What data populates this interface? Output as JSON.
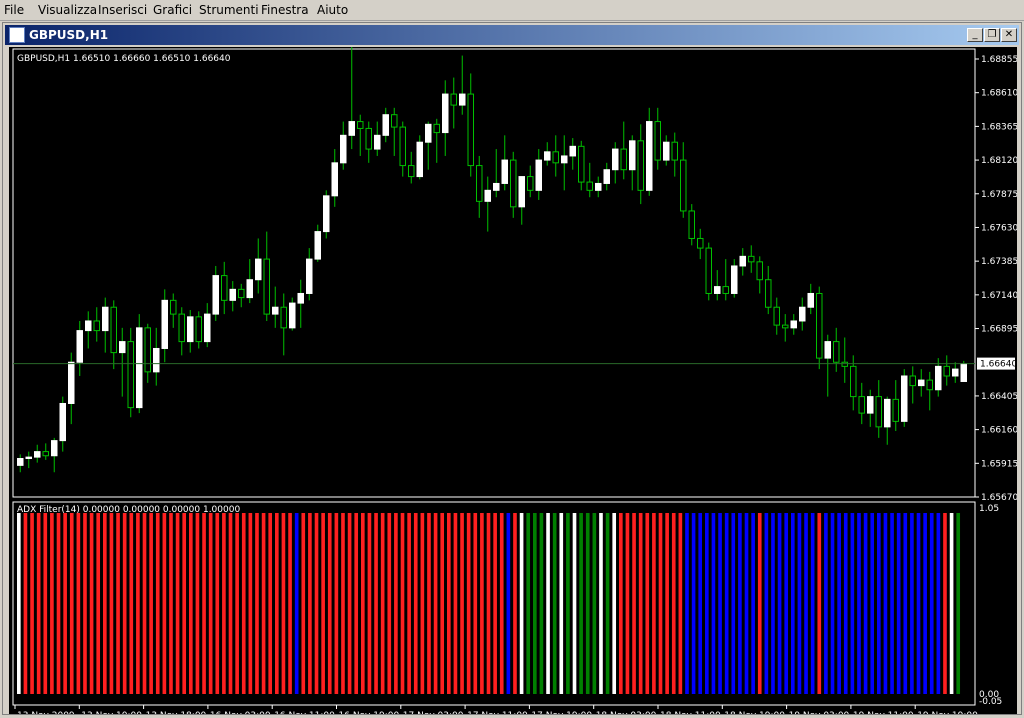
{
  "menu": {
    "items": [
      {
        "label": "File",
        "name": "menu-file"
      },
      {
        "label": "Visualizza",
        "name": "menu-visualizza"
      },
      {
        "label": "Inserisci",
        "name": "menu-inserisci"
      },
      {
        "label": "Grafici",
        "name": "menu-grafici"
      },
      {
        "label": "Strumenti",
        "name": "menu-strumenti"
      },
      {
        "label": "Finestra",
        "name": "menu-finestra"
      },
      {
        "label": "Aiuto",
        "name": "menu-aiuto"
      }
    ]
  },
  "window": {
    "title": "GBPUSD,H1",
    "minimize_label": "_",
    "restore_label": "❐",
    "close_label": "✕"
  },
  "colors": {
    "candle_up_fill": "#ffffff",
    "candle_wick": "#00c000",
    "bar_red": "#ff2020",
    "bar_blue": "#0000ff",
    "bar_green": "#008000",
    "bar_white": "#ffffff",
    "price_line": "#2a6a2a"
  },
  "price_panel": {
    "info": "GBPUSD,H1  1.66510 1.66660 1.66510 1.66640",
    "current_price": "1.66640",
    "y_ticks": [
      "1.68855",
      "1.68610",
      "1.68365",
      "1.68120",
      "1.67875",
      "1.67630",
      "1.67385",
      "1.67140",
      "1.66895",
      "1.66640",
      "1.66405",
      "1.66160",
      "1.65915",
      "1.65670"
    ]
  },
  "indicator_panel": {
    "info": "ADX Filter(14) 0.00000 0.00000 0.00000 1.00000",
    "y_ticks": [
      "1.05",
      "0.00",
      "-0.05"
    ]
  },
  "time_axis": {
    "labels": [
      "13 Nov 2009",
      "13 Nov 10:00",
      "13 Nov 18:00",
      "16 Nov 03:00",
      "16 Nov 11:00",
      "16 Nov 19:00",
      "17 Nov 03:00",
      "17 Nov 11:00",
      "17 Nov 19:00",
      "18 Nov 03:00",
      "18 Nov 11:00",
      "18 Nov 19:00",
      "19 Nov 03:00",
      "19 Nov 11:00",
      "19 Nov 19:00"
    ]
  },
  "chart_data": {
    "type": "candlestick",
    "title": "GBPUSD,H1",
    "ylim": [
      1.6567,
      1.691
    ],
    "candles": [
      [
        1.659,
        1.6598,
        1.6585,
        1.6595
      ],
      [
        1.6595,
        1.66,
        1.6588,
        1.6596
      ],
      [
        1.6596,
        1.6605,
        1.6592,
        1.66
      ],
      [
        1.66,
        1.6606,
        1.6594,
        1.6597
      ],
      [
        1.6597,
        1.661,
        1.6585,
        1.6608
      ],
      [
        1.6608,
        1.664,
        1.66,
        1.6635
      ],
      [
        1.6635,
        1.6672,
        1.662,
        1.6665
      ],
      [
        1.6665,
        1.6695,
        1.6655,
        1.6688
      ],
      [
        1.6688,
        1.6702,
        1.6675,
        1.6695
      ],
      [
        1.6695,
        1.6705,
        1.668,
        1.6688
      ],
      [
        1.6688,
        1.6712,
        1.6672,
        1.6705
      ],
      [
        1.6705,
        1.671,
        1.666,
        1.6672
      ],
      [
        1.6672,
        1.669,
        1.664,
        1.668
      ],
      [
        1.668,
        1.669,
        1.6625,
        1.6632
      ],
      [
        1.6632,
        1.67,
        1.6628,
        1.669
      ],
      [
        1.669,
        1.6693,
        1.665,
        1.6658
      ],
      [
        1.6658,
        1.669,
        1.6648,
        1.6675
      ],
      [
        1.6675,
        1.6718,
        1.6665,
        1.671
      ],
      [
        1.671,
        1.6715,
        1.669,
        1.67
      ],
      [
        1.67,
        1.6705,
        1.667,
        1.668
      ],
      [
        1.668,
        1.6703,
        1.6672,
        1.6698
      ],
      [
        1.6698,
        1.6702,
        1.6675,
        1.668
      ],
      [
        1.668,
        1.6708,
        1.6676,
        1.67
      ],
      [
        1.67,
        1.6735,
        1.6695,
        1.6728
      ],
      [
        1.6728,
        1.6738,
        1.67,
        1.671
      ],
      [
        1.671,
        1.6724,
        1.6702,
        1.6718
      ],
      [
        1.6718,
        1.6722,
        1.6705,
        1.6712
      ],
      [
        1.6712,
        1.674,
        1.6708,
        1.6725
      ],
      [
        1.6725,
        1.6755,
        1.6715,
        1.674
      ],
      [
        1.674,
        1.676,
        1.6695,
        1.67
      ],
      [
        1.67,
        1.672,
        1.669,
        1.6705
      ],
      [
        1.6705,
        1.6715,
        1.667,
        1.669
      ],
      [
        1.669,
        1.6712,
        1.6688,
        1.6708
      ],
      [
        1.6708,
        1.6725,
        1.669,
        1.6715
      ],
      [
        1.6715,
        1.6748,
        1.671,
        1.674
      ],
      [
        1.674,
        1.6765,
        1.6738,
        1.676
      ],
      [
        1.676,
        1.679,
        1.6755,
        1.6786
      ],
      [
        1.6786,
        1.682,
        1.6778,
        1.681
      ],
      [
        1.681,
        1.684,
        1.6805,
        1.683
      ],
      [
        1.683,
        1.6895,
        1.682,
        1.684
      ],
      [
        1.684,
        1.6845,
        1.6815,
        1.6835
      ],
      [
        1.6835,
        1.684,
        1.681,
        1.682
      ],
      [
        1.682,
        1.684,
        1.6815,
        1.683
      ],
      [
        1.683,
        1.685,
        1.6825,
        1.6845
      ],
      [
        1.6845,
        1.685,
        1.6815,
        1.6836
      ],
      [
        1.6836,
        1.684,
        1.68,
        1.6808
      ],
      [
        1.6808,
        1.6818,
        1.6795,
        1.68
      ],
      [
        1.68,
        1.683,
        1.6798,
        1.6825
      ],
      [
        1.6825,
        1.684,
        1.6805,
        1.6838
      ],
      [
        1.6838,
        1.6842,
        1.681,
        1.6832
      ],
      [
        1.6832,
        1.687,
        1.6815,
        1.686
      ],
      [
        1.686,
        1.6872,
        1.6835,
        1.6852
      ],
      [
        1.6852,
        1.6888,
        1.6845,
        1.686
      ],
      [
        1.686,
        1.6875,
        1.68,
        1.6808
      ],
      [
        1.6808,
        1.6815,
        1.677,
        1.6782
      ],
      [
        1.6782,
        1.68,
        1.676,
        1.679
      ],
      [
        1.679,
        1.682,
        1.6785,
        1.6795
      ],
      [
        1.6795,
        1.683,
        1.679,
        1.6812
      ],
      [
        1.6812,
        1.6818,
        1.677,
        1.6778
      ],
      [
        1.6778,
        1.68,
        1.6765,
        1.68
      ],
      [
        1.68,
        1.6808,
        1.6785,
        1.679
      ],
      [
        1.679,
        1.682,
        1.6783,
        1.6812
      ],
      [
        1.6812,
        1.6825,
        1.6808,
        1.6818
      ],
      [
        1.6818,
        1.683,
        1.68,
        1.681
      ],
      [
        1.681,
        1.683,
        1.679,
        1.6815
      ],
      [
        1.6815,
        1.6828,
        1.6805,
        1.6822
      ],
      [
        1.6822,
        1.6826,
        1.679,
        1.6796
      ],
      [
        1.6796,
        1.681,
        1.6785,
        1.679
      ],
      [
        1.679,
        1.68,
        1.6785,
        1.6795
      ],
      [
        1.6795,
        1.681,
        1.679,
        1.6805
      ],
      [
        1.6805,
        1.6825,
        1.6795,
        1.682
      ],
      [
        1.682,
        1.684,
        1.6798,
        1.6805
      ],
      [
        1.6805,
        1.683,
        1.679,
        1.6826
      ],
      [
        1.6826,
        1.6838,
        1.678,
        1.679
      ],
      [
        1.679,
        1.685,
        1.6786,
        1.684
      ],
      [
        1.684,
        1.685,
        1.6805,
        1.6812
      ],
      [
        1.6812,
        1.683,
        1.6808,
        1.6825
      ],
      [
        1.6825,
        1.6832,
        1.68,
        1.6812
      ],
      [
        1.6812,
        1.6825,
        1.677,
        1.6775
      ],
      [
        1.6775,
        1.678,
        1.675,
        1.6755
      ],
      [
        1.6755,
        1.6762,
        1.674,
        1.6748
      ],
      [
        1.6748,
        1.6752,
        1.671,
        1.6715
      ],
      [
        1.6715,
        1.6732,
        1.671,
        1.672
      ],
      [
        1.672,
        1.674,
        1.671,
        1.6715
      ],
      [
        1.6715,
        1.674,
        1.6712,
        1.6735
      ],
      [
        1.6735,
        1.6748,
        1.6728,
        1.6742
      ],
      [
        1.6742,
        1.675,
        1.673,
        1.6738
      ],
      [
        1.6738,
        1.6742,
        1.6715,
        1.6725
      ],
      [
        1.6725,
        1.6735,
        1.67,
        1.6705
      ],
      [
        1.6705,
        1.6712,
        1.6685,
        1.6692
      ],
      [
        1.6692,
        1.67,
        1.668,
        1.669
      ],
      [
        1.669,
        1.67,
        1.6685,
        1.6695
      ],
      [
        1.6695,
        1.6712,
        1.6688,
        1.6705
      ],
      [
        1.6705,
        1.6722,
        1.67,
        1.6715
      ],
      [
        1.6715,
        1.672,
        1.666,
        1.6668
      ],
      [
        1.6668,
        1.6685,
        1.664,
        1.668
      ],
      [
        1.668,
        1.669,
        1.6658,
        1.6665
      ],
      [
        1.6665,
        1.6683,
        1.665,
        1.6662
      ],
      [
        1.6662,
        1.667,
        1.663,
        1.664
      ],
      [
        1.664,
        1.665,
        1.662,
        1.6628
      ],
      [
        1.6628,
        1.6645,
        1.6618,
        1.664
      ],
      [
        1.664,
        1.6652,
        1.661,
        1.6618
      ],
      [
        1.6618,
        1.664,
        1.6605,
        1.6638
      ],
      [
        1.6638,
        1.6652,
        1.6615,
        1.6622
      ],
      [
        1.6622,
        1.666,
        1.6618,
        1.6655
      ],
      [
        1.6655,
        1.6662,
        1.6635,
        1.6648
      ],
      [
        1.6648,
        1.666,
        1.664,
        1.6652
      ],
      [
        1.6652,
        1.6658,
        1.663,
        1.6645
      ],
      [
        1.6645,
        1.6668,
        1.664,
        1.6662
      ],
      [
        1.6662,
        1.667,
        1.6648,
        1.6655
      ],
      [
        1.6655,
        1.6665,
        1.665,
        1.666
      ],
      [
        1.6651,
        1.6666,
        1.6651,
        1.6664
      ]
    ],
    "indicator_bars": "WRRRRRRRRRRRRRRRRRRRRRRRRRRRRRRRRRRRRRRRRRBRRRRRRRRRRRRRRRRRRRRRRRRRRRRRRRBRWGGGWGWGWGGGWGWRRRRRRRRRRBBBBBBBBBBBRBBBBBBBBRBBBBBBBBBBBBBBBBBBRWG"
  }
}
